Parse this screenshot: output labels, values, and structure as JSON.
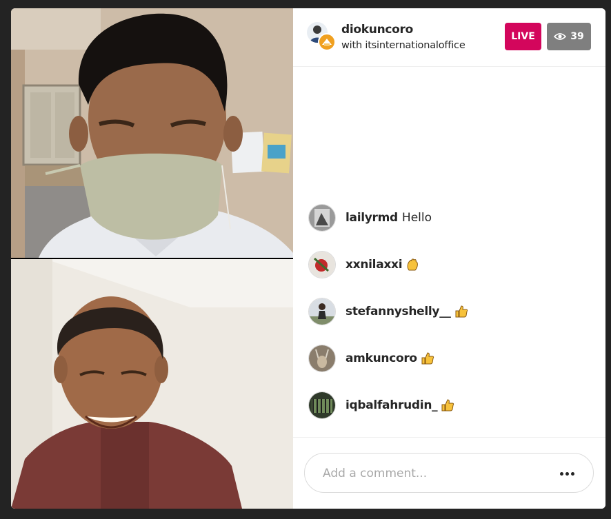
{
  "host": {
    "username": "diokuncoro",
    "with_text": "with itsinternationaloffice"
  },
  "live_badge": "LIVE",
  "viewers": {
    "icon": "eye-icon",
    "count": "39"
  },
  "comments": [
    {
      "username": "lailyrmd",
      "message": "Hello",
      "emoji": ""
    },
    {
      "username": "xxnilaxxi",
      "message": "",
      "emoji": "waving-hand-icon"
    },
    {
      "username": "stefannyshelly__",
      "message": "",
      "emoji": "thumbs-up-icon"
    },
    {
      "username": "amkuncoro",
      "message": "",
      "emoji": "thumbs-up-icon"
    },
    {
      "username": "iqbalfahrudin_",
      "message": "",
      "emoji": "thumbs-up-icon"
    }
  ],
  "comment_input": {
    "placeholder": "Add a comment...",
    "value": ""
  },
  "colors": {
    "live": "#d3065c",
    "viewer_badge": "#7f7f7f",
    "background": "#232323",
    "emoji": "#f7c23b"
  }
}
